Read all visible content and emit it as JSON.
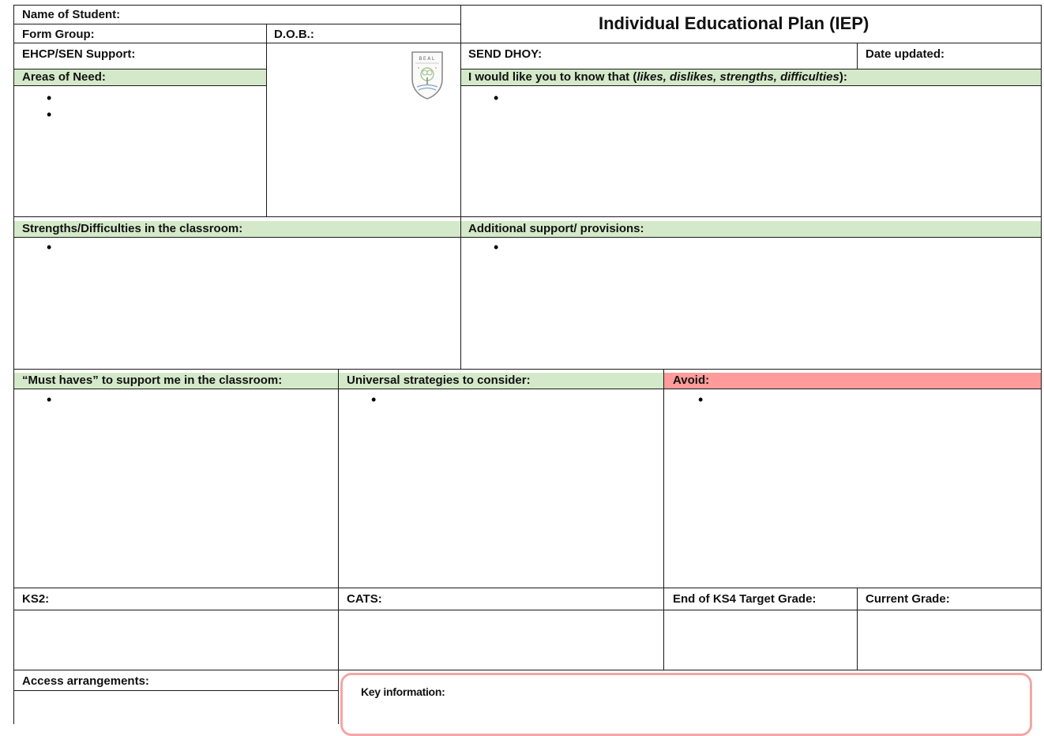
{
  "header": {
    "title": "Individual Educational Plan (IEP)",
    "name_of_student": "Name of Student:",
    "form_group": "Form Group:",
    "dob": "D.O.B.:",
    "ehcp": "EHCP/SEN Support:",
    "send_dhoy": "SEND DHOY:",
    "date_updated": "Date updated:",
    "logo_text": "BEAL"
  },
  "sections": {
    "areas_of_need": "Areas of Need:",
    "know_that_prefix": "I would like you to know that (",
    "know_that_italic": "likes, dislikes, strengths, difficulties",
    "know_that_suffix": "):",
    "strengths": "Strengths/Difficulties in the classroom:",
    "additional": "Additional support/ provisions:",
    "must_haves": "“Must haves” to support me in the classroom:",
    "universal": "Universal strategies to consider:",
    "avoid": "Avoid:"
  },
  "grades": {
    "ks2": "KS2:",
    "cats": "CATS:",
    "target": "End of KS4 Target Grade:",
    "current": "Current Grade:"
  },
  "footer": {
    "access": "Access arrangements:",
    "key_info": "Key information:"
  },
  "bullet": "•",
  "colors": {
    "header_green": "#d4e9c9",
    "avoid_red": "#ff9b9b",
    "key_border": "#f4a6a6"
  }
}
